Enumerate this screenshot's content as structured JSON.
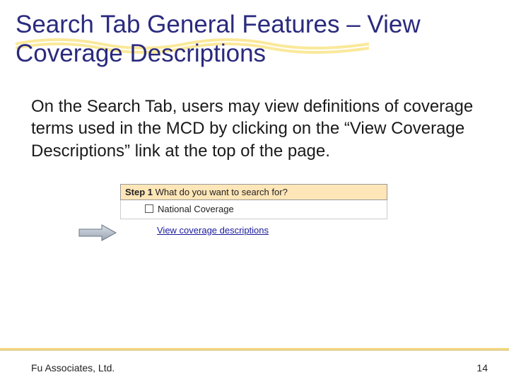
{
  "title": "Search Tab General Features – View Coverage Descriptions",
  "body": "On the Search Tab, users may view definitions of coverage terms used in the MCD by clicking on the “View Coverage Descriptions” link at the top of the page.",
  "step": {
    "label": "Step 1",
    "question": "What do you want to search for?"
  },
  "checkbox_label": "National Coverage",
  "link_text": "View coverage descriptions",
  "footer_left": "Fu Associates, Ltd.",
  "footer_right": "14"
}
